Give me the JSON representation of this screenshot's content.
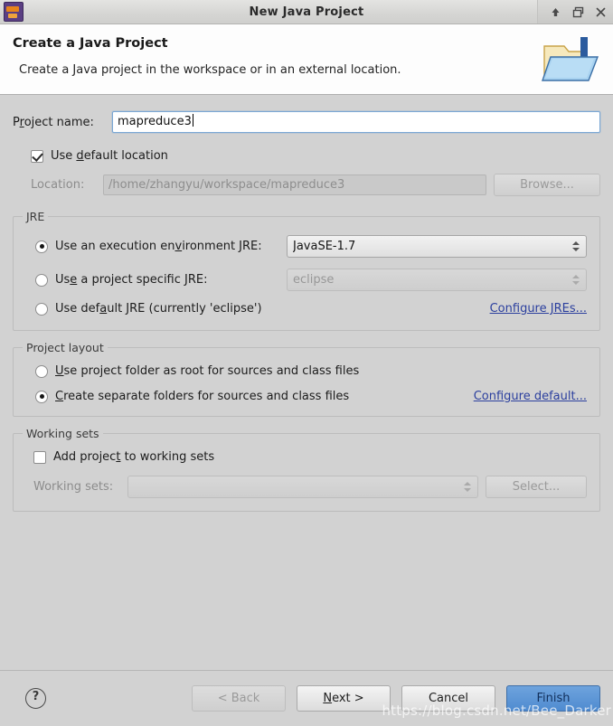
{
  "window": {
    "title": "New Java Project",
    "app_icon": "eclipse-icon",
    "controls": [
      {
        "name": "shade-button",
        "icon": "arrow-up-icon"
      },
      {
        "name": "restore-button",
        "icon": "restore-window-icon"
      },
      {
        "name": "close-button",
        "icon": "close-icon"
      }
    ]
  },
  "header": {
    "title": "Create a Java Project",
    "subtitle": "Create a Java project in the workspace or in an external location.",
    "icon": "java-project-folder-icon"
  },
  "project_name": {
    "label_before": "P",
    "label_mnemonic": "r",
    "label_after": "oject name:",
    "value": "mapreduce3",
    "placeholder": ""
  },
  "use_default_location": {
    "label_before": "Use ",
    "label_mnemonic": "d",
    "label_after": "efault location",
    "checked": true
  },
  "location": {
    "label": "Location:",
    "value": "/home/zhangyu/workspace/mapreduce3",
    "browse_label": "Browse...",
    "enabled": false
  },
  "jre": {
    "group_title": "JRE",
    "options": [
      {
        "name": "execution-environment",
        "label_before": "Use an execution en",
        "label_mnemonic": "v",
        "label_after": "ironment JRE:",
        "selected": true,
        "combo_value": "JavaSE-1.7",
        "combo_enabled": true
      },
      {
        "name": "project-specific",
        "label_before": "Us",
        "label_mnemonic": "e",
        "label_after": " a project specific JRE:",
        "selected": false,
        "combo_value": "eclipse",
        "combo_enabled": false
      },
      {
        "name": "default-jre",
        "label_before": "Use def",
        "label_mnemonic": "a",
        "label_after": "ult JRE (currently 'eclipse')",
        "selected": false
      }
    ],
    "configure_link": "Configure JREs..."
  },
  "project_layout": {
    "group_title": "Project layout",
    "options": [
      {
        "name": "project-folder-root",
        "label_before": "",
        "label_mnemonic": "U",
        "label_after": "se project folder as root for sources and class files",
        "selected": false
      },
      {
        "name": "separate-folders",
        "label_before": "",
        "label_mnemonic": "C",
        "label_after": "reate separate folders for sources and class files",
        "selected": true
      }
    ],
    "configure_link": "Configure default..."
  },
  "working_sets": {
    "group_title": "Working sets",
    "add_checkbox": {
      "label_before": "Add projec",
      "label_mnemonic": "t",
      "label_after": " to working sets",
      "checked": false
    },
    "label": "Working sets:",
    "value": "",
    "select_label": "Select...",
    "enabled": false
  },
  "footer": {
    "help_glyph": "?",
    "buttons": [
      {
        "name": "back-button",
        "label": "< Back",
        "enabled": false,
        "primary": false
      },
      {
        "name": "next-button",
        "label": "Next >",
        "enabled": true,
        "primary": false,
        "mnemonic_index": 1
      },
      {
        "name": "cancel-button",
        "label": "Cancel",
        "enabled": true,
        "primary": false
      },
      {
        "name": "finish-button",
        "label": "Finish",
        "enabled": true,
        "primary": true
      }
    ],
    "watermark": "https://blog.csdn.net/Bee_Darker"
  },
  "colors": {
    "dialog_background": "#d2d2d2",
    "header_background": "#fdfdfd",
    "primary_button": "#5a95d6",
    "link": "#2b3f9e",
    "input_focus_border": "#7aa7d4"
  }
}
